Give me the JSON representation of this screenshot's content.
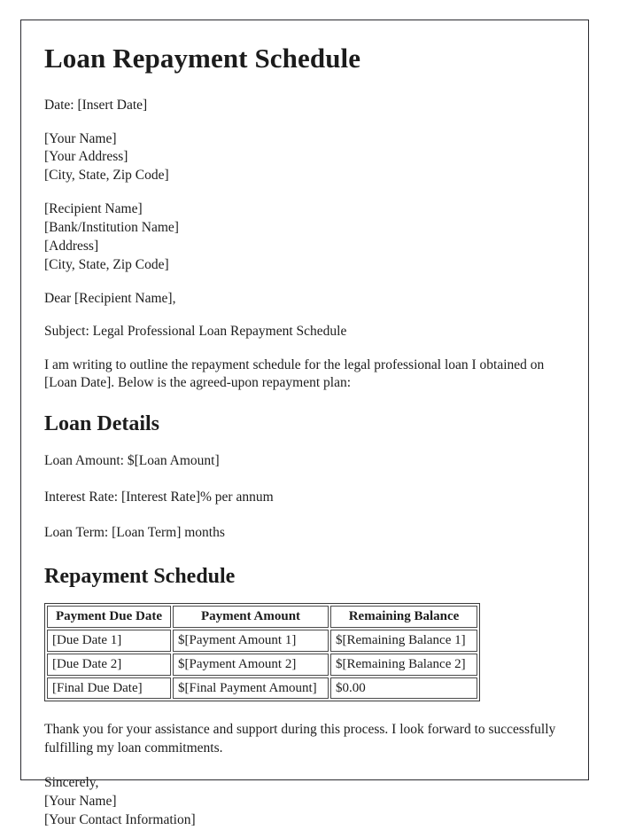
{
  "document": {
    "title": "Loan Repayment Schedule",
    "date_line": "Date: [Insert Date]",
    "sender_block": [
      "[Your Name]",
      "[Your Address]",
      "[City, State, Zip Code]"
    ],
    "recipient_block": [
      "[Recipient Name]",
      "[Bank/Institution Name]",
      "[Address]",
      "[City, State, Zip Code]"
    ],
    "salutation": "Dear [Recipient Name],",
    "subject_line": "Subject: Legal Professional Loan Repayment Schedule",
    "intro_paragraph": "I am writing to outline the repayment schedule for the legal professional loan I obtained on [Loan Date]. Below is the agreed-upon repayment plan:",
    "loan_details": {
      "heading": "Loan Details",
      "items": [
        "Loan Amount: $[Loan Amount]",
        "Interest Rate: [Interest Rate]% per annum",
        "Loan Term: [Loan Term] months"
      ]
    },
    "repayment_schedule": {
      "heading": "Repayment Schedule",
      "columns": [
        "Payment Due Date",
        "Payment Amount",
        "Remaining Balance"
      ],
      "rows": [
        [
          "[Due Date 1]",
          "$[Payment Amount 1]",
          "$[Remaining Balance 1]"
        ],
        [
          "[Due Date 2]",
          "$[Payment Amount 2]",
          "$[Remaining Balance 2]"
        ],
        [
          "[Final Due Date]",
          "$[Final Payment Amount]",
          "$0.00"
        ]
      ]
    },
    "closing_paragraph": "Thank you for your assistance and support during this process. I look forward to successfully fulfilling my loan commitments.",
    "signature_block": [
      "Sincerely,",
      "[Your Name]",
      "[Your Contact Information]"
    ]
  }
}
